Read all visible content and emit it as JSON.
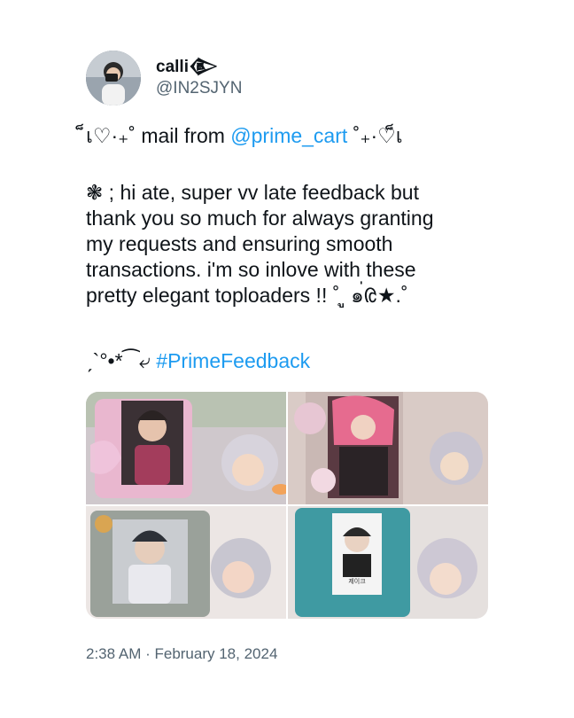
{
  "user": {
    "display_name": "calli𒀛",
    "handle": "@IN2SJYN"
  },
  "tweet": {
    "line1_prefix": "็เ♡·₊˚ mail from ",
    "mention": "@prime_cart",
    "line1_suffix": "  ˚₊·♡็เ",
    "body_lines": [
      "❃ ; hi ate, super vv late feedback but",
      "thank you so much for always granting",
      "my requests and ensuring smooth",
      "transactions. i'm so inlove with these",
      "pretty elegant toploaders !! ˚ ู ๑่ᱭ★.˚"
    ],
    "hashtag_prefix": "ˏ`°•*⁀⤶ ",
    "hashtag": "#PrimeFeedback"
  },
  "timestamp": "2:38 AM · February 18, 2024",
  "media": {
    "photos": [
      {
        "name": "photo-pink-frame",
        "label": ""
      },
      {
        "name": "photo-floral-frame",
        "label": ""
      },
      {
        "name": "photo-gray-frame",
        "label": ""
      },
      {
        "name": "photo-teal-frame",
        "label": "제이크"
      }
    ]
  }
}
